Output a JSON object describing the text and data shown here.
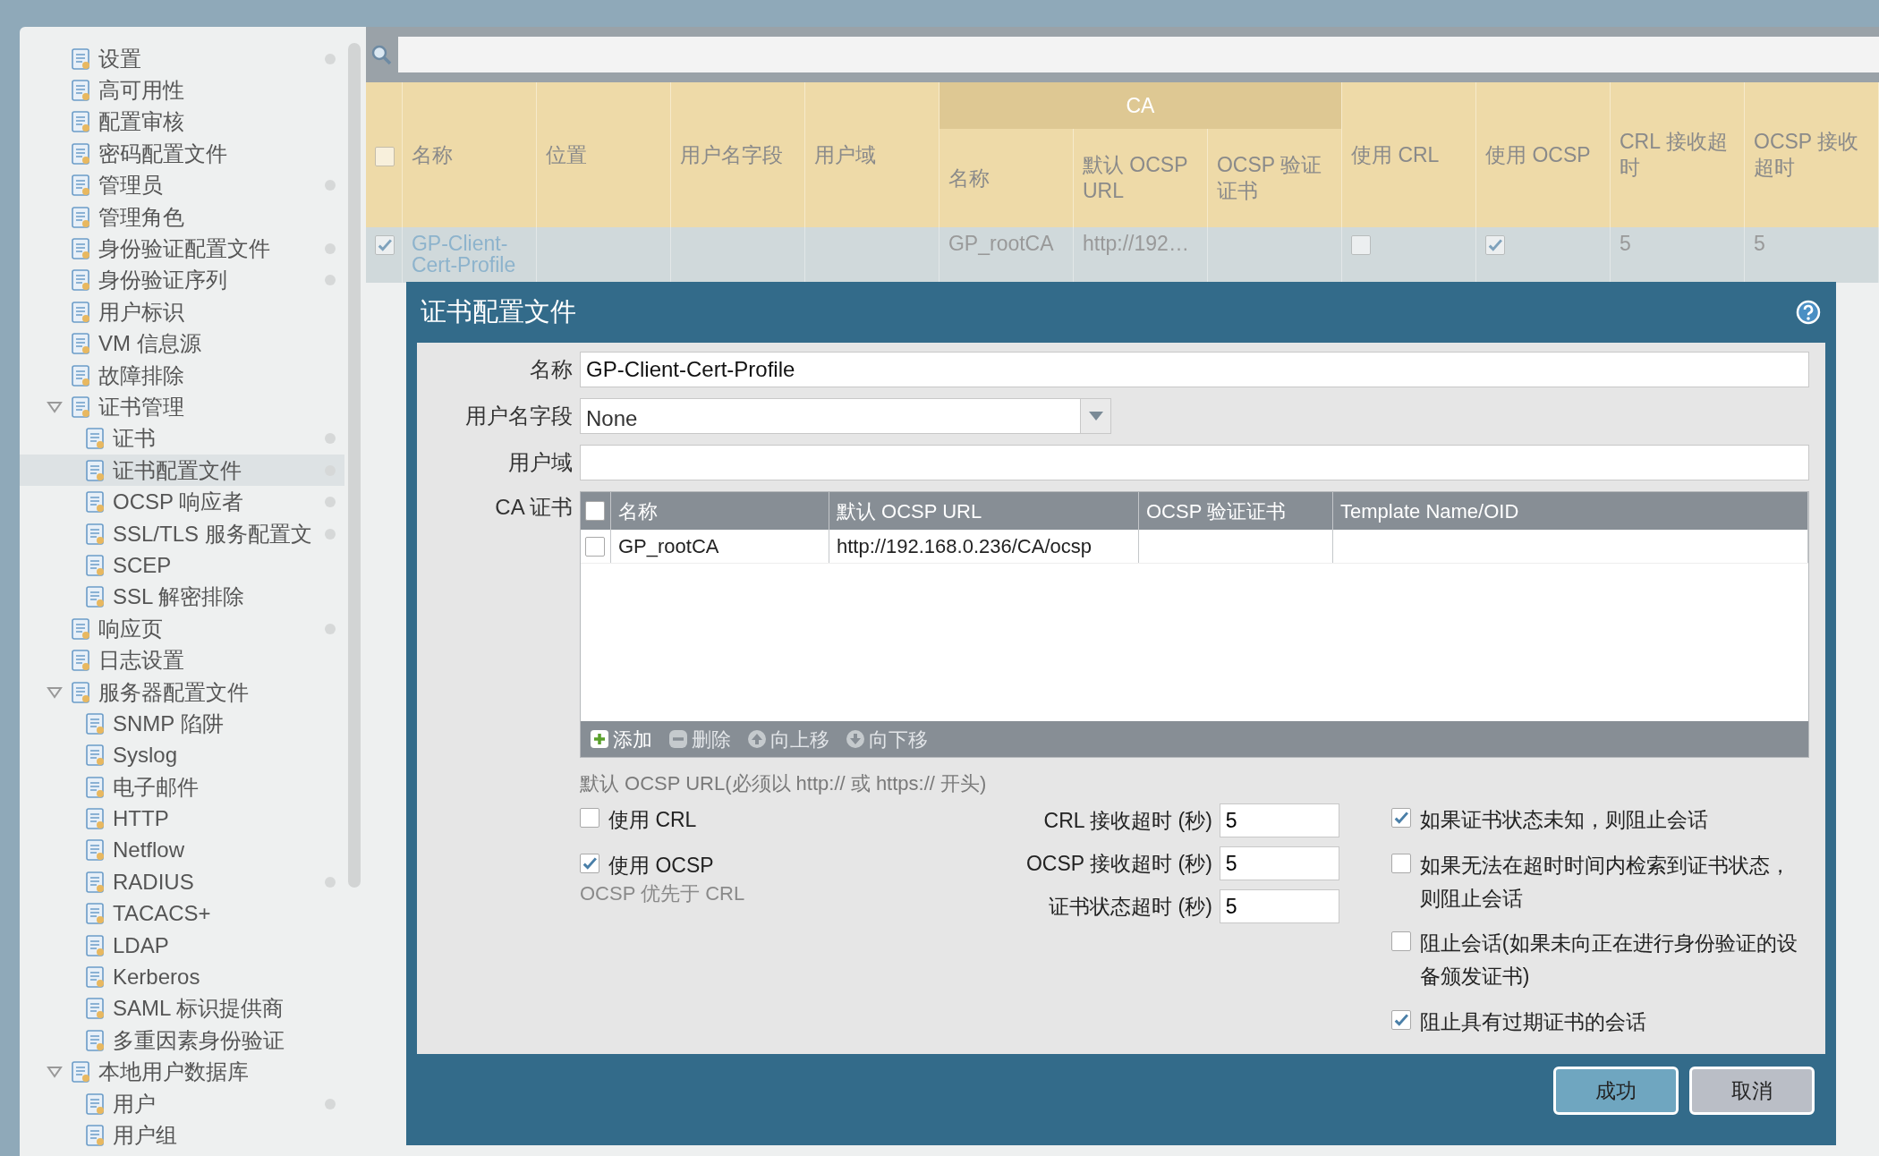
{
  "sidebar": {
    "items": [
      {
        "label": "设置",
        "selected": false,
        "dot": true
      },
      {
        "label": "高可用性",
        "selected": false,
        "dot": false
      },
      {
        "label": "配置审核",
        "selected": false,
        "dot": false
      },
      {
        "label": "密码配置文件",
        "selected": false,
        "dot": false
      },
      {
        "label": "管理员",
        "selected": false,
        "dot": true
      },
      {
        "label": "管理角色",
        "selected": false,
        "dot": false
      },
      {
        "label": "身份验证配置文件",
        "selected": false,
        "dot": true
      },
      {
        "label": "身份验证序列",
        "selected": false,
        "dot": true
      },
      {
        "label": "用户标识",
        "selected": false,
        "dot": false
      },
      {
        "label": "VM 信息源",
        "selected": false,
        "dot": false
      },
      {
        "label": "故障排除",
        "selected": false,
        "dot": false
      },
      {
        "label": "证书管理",
        "selected": false,
        "dot": false,
        "expanded": true,
        "children": [
          {
            "label": "证书",
            "selected": false,
            "dot": true
          },
          {
            "label": "证书配置文件",
            "selected": true,
            "dot": true
          },
          {
            "label": "OCSP 响应者",
            "selected": false,
            "dot": true
          },
          {
            "label": "SSL/TLS 服务配置文",
            "selected": false,
            "dot": true
          },
          {
            "label": "SCEP",
            "selected": false,
            "dot": false
          },
          {
            "label": "SSL 解密排除",
            "selected": false,
            "dot": false
          }
        ]
      },
      {
        "label": "响应页",
        "selected": false,
        "dot": true
      },
      {
        "label": "日志设置",
        "selected": false,
        "dot": false
      },
      {
        "label": "服务器配置文件",
        "selected": false,
        "dot": false,
        "expanded": true,
        "children": [
          {
            "label": "SNMP 陷阱",
            "selected": false,
            "dot": false
          },
          {
            "label": "Syslog",
            "selected": false,
            "dot": false
          },
          {
            "label": "电子邮件",
            "selected": false,
            "dot": false
          },
          {
            "label": "HTTP",
            "selected": false,
            "dot": false
          },
          {
            "label": "Netflow",
            "selected": false,
            "dot": false
          },
          {
            "label": "RADIUS",
            "selected": false,
            "dot": true
          },
          {
            "label": "TACACS+",
            "selected": false,
            "dot": false
          },
          {
            "label": "LDAP",
            "selected": false,
            "dot": false
          },
          {
            "label": "Kerberos",
            "selected": false,
            "dot": false
          },
          {
            "label": "SAML 标识提供商",
            "selected": false,
            "dot": false
          },
          {
            "label": "多重因素身份验证",
            "selected": false,
            "dot": false
          }
        ]
      },
      {
        "label": "本地用户数据库",
        "selected": false,
        "dot": false,
        "expanded": true,
        "children": [
          {
            "label": "用户",
            "selected": false,
            "dot": true
          },
          {
            "label": "用户组",
            "selected": false,
            "dot": false
          }
        ]
      }
    ]
  },
  "table": {
    "header_checked": false,
    "columns_before": [
      "名称",
      "位置",
      "用户名字段",
      "用户域"
    ],
    "ca_group": {
      "label": "CA",
      "columns": [
        "名称",
        "默认 OCSP URL",
        "OCSP 验证证书"
      ]
    },
    "columns_after": [
      "使用 CRL",
      "使用 OCSP",
      "CRL 接收超时",
      "OCSP 接收超时"
    ],
    "rows": [
      {
        "checked": true,
        "cells": [
          {
            "kind": "link",
            "text": "GP-Client-Cert-Profile"
          },
          {
            "kind": "empty"
          },
          {
            "kind": "empty"
          },
          {
            "kind": "empty"
          },
          {
            "kind": "text",
            "text": "GP_rootCA"
          },
          {
            "kind": "text",
            "text": "http://192…"
          },
          {
            "kind": "empty"
          },
          {
            "kind": "checkbox",
            "checked": false
          },
          {
            "kind": "checkbox",
            "checked": true
          },
          {
            "kind": "text",
            "text": "5"
          },
          {
            "kind": "text",
            "text": "5"
          }
        ]
      }
    ]
  },
  "dialog": {
    "title": "证书配置文件",
    "fields": [
      {
        "kind": "input",
        "label": "名称",
        "value": "GP-Client-Cert-Profile"
      },
      {
        "kind": "select",
        "label": "用户名字段",
        "value": "None"
      },
      {
        "kind": "input",
        "label": "用户域"
      }
    ],
    "ca_certs": {
      "label": "CA 证书",
      "header_checked": false,
      "columns": [
        "名称",
        "默认 OCSP URL",
        "OCSP 验证证书",
        "Template Name/OID"
      ],
      "rows": [
        {
          "checked": false,
          "cells": [
            "GP_rootCA",
            "http://192.168.0.236/CA/ocsp"
          ]
        }
      ],
      "actions": [
        {
          "kind": "add",
          "label": "添加",
          "disabled": false
        },
        {
          "kind": "delete",
          "label": "删除",
          "disabled": true
        },
        {
          "kind": "up",
          "label": "向上移",
          "disabled": true
        },
        {
          "kind": "down",
          "label": "向下移",
          "disabled": true
        }
      ]
    },
    "hint": "默认 OCSP URL(必须以 http:// 或 https:// 开头)",
    "left_options": [
      {
        "label": "使用 CRL",
        "checked": false
      },
      {
        "label": "使用 OCSP",
        "checked": true,
        "note": "OCSP 优先于 CRL"
      }
    ],
    "timeouts": [
      {
        "label": "CRL 接收超时 (秒)",
        "value": "5"
      },
      {
        "label": "OCSP 接收超时 (秒)",
        "value": "5"
      },
      {
        "label": "证书状态超时 (秒)",
        "value": "5"
      }
    ],
    "right_options": [
      {
        "label": "如果证书状态未知，则阻止会话",
        "checked": true
      },
      {
        "label": "如果无法在超时时间内检索到证书状态，则阻止会话",
        "checked": false
      },
      {
        "label": "阻止会话(如果未向正在进行身份验证的设备颁发证书)",
        "checked": false
      },
      {
        "label": "阻止具有过期证书的会话",
        "checked": true
      }
    ],
    "buttons": [
      {
        "kind": "primary",
        "label": "成功"
      },
      {
        "kind": "secondary",
        "label": "取消"
      }
    ]
  }
}
